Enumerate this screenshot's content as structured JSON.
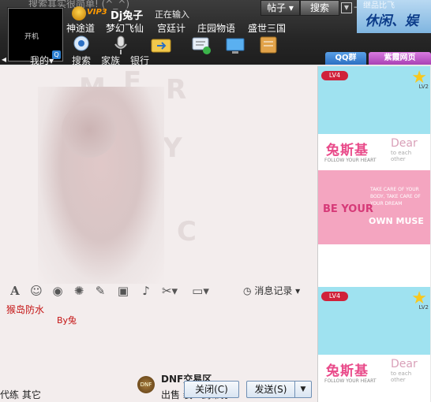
{
  "header": {
    "bg_text": "搜索其实很简单! (^_^)",
    "avatar_label": "开机",
    "vip_badge": "VIP3",
    "nickname": "Dj兔子",
    "status": "正在输入",
    "tie_label": "帖子",
    "search_label": "搜索",
    "banner_text": "休闲、娱",
    "banner_sub": "继品比飞"
  },
  "game_tabs": [
    "神途道",
    "梦幻飞仙",
    "宫廷计",
    "庄园物语",
    "盛世三国"
  ],
  "bottom_nav": {
    "mine": "我的",
    "items": [
      "搜索",
      "家族",
      "银行"
    ]
  },
  "right_tabs": {
    "qqgroup": "QQ群",
    "purple": "紫霞网页"
  },
  "ads": {
    "lv_badge": "LV4",
    "lv2_label": "LV2",
    "brand_cn": "兔斯基",
    "dear": "Dear",
    "dear_sub": "to each other",
    "follow": "FOLLOW YOUR HEART",
    "take_care": "TAKE CARE OF YOUR BODY, TAKE CARE OF YOUR DREAM",
    "be_your": "BE YOUR",
    "own_muse": "OWN MUSE"
  },
  "toolbar": {
    "message_record": "消息记录"
  },
  "chat": {
    "watermark": "猴岛防水",
    "by": "By兔"
  },
  "bottom": {
    "left_text": "代练 其它",
    "dnf_title": "DNF交易区",
    "dnf_sub": "出售 装...剑帝券",
    "close": "关闭(C)",
    "send": "发送(S)"
  },
  "colors": {
    "accent_red": "#c41414",
    "frame_dark": "#262626",
    "ad_blue": "#9fe2f0",
    "ad_pink": "#f4a5c0"
  }
}
